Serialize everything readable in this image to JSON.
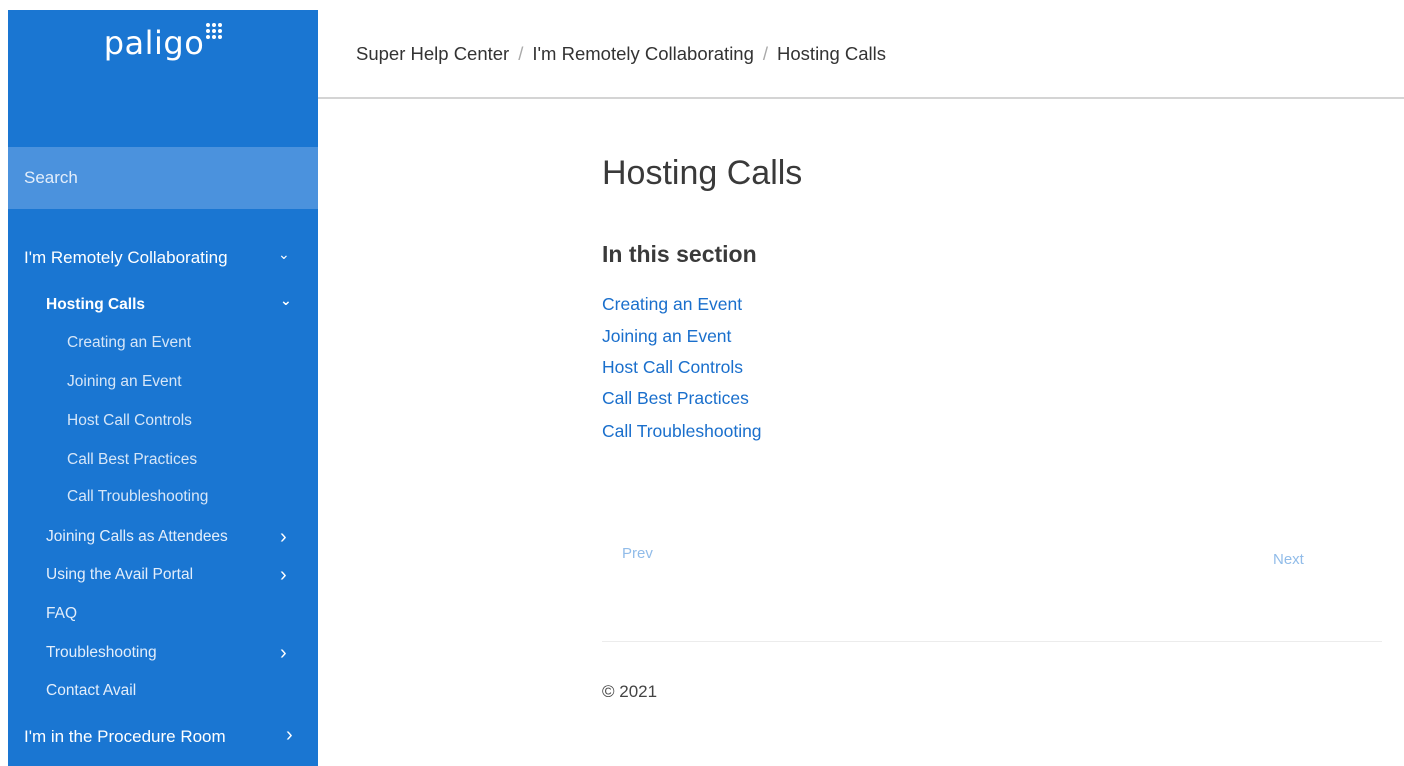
{
  "brand": {
    "logo_text": "paligo",
    "logo_icon": "dot-grid-icon"
  },
  "sidebar": {
    "search_label": "Search",
    "items": [
      {
        "label": "I'm Remotely Collaborating",
        "level": 0,
        "chevron": "chevron-down-icon"
      },
      {
        "label": "Hosting Calls",
        "level": 1,
        "active": true,
        "chevron": "chevron-down-icon"
      },
      {
        "label": "Creating an Event",
        "level": 2
      },
      {
        "label": "Joining an Event",
        "level": 2
      },
      {
        "label": "Host Call Controls",
        "level": 2
      },
      {
        "label": "Call Best Practices",
        "level": 2
      },
      {
        "label": "Call Troubleshooting",
        "level": 2
      },
      {
        "label": "Joining Calls as Attendees",
        "level": 1,
        "chevron": "chevron-right-icon"
      },
      {
        "label": "Using the Avail Portal",
        "level": 1,
        "chevron": "chevron-right-icon"
      },
      {
        "label": "FAQ",
        "level": 1
      },
      {
        "label": "Troubleshooting",
        "level": 1,
        "chevron": "chevron-right-icon"
      },
      {
        "label": "Contact Avail",
        "level": 1
      },
      {
        "label": "I'm in the Procedure Room",
        "level": 0,
        "chevron": "chevron-right-icon"
      }
    ],
    "chevron_down": "⌄",
    "chevron_right": "›"
  },
  "breadcrumb": {
    "items": [
      "Super Help Center",
      "I'm Remotely Collaborating",
      "Hosting Calls"
    ],
    "separator": "/"
  },
  "main": {
    "title": "Hosting Calls",
    "section_title": "In this section",
    "links": [
      "Creating an Event",
      "Joining an Event",
      "Host Call Controls",
      "Call Best Practices",
      "Call Troubleshooting"
    ],
    "prev_label": "Prev",
    "next_label": "Next"
  },
  "footer": {
    "copyright": "© 2021"
  },
  "colors": {
    "sidebar_bg": "#1a76d2",
    "search_bg": "#4b92dd",
    "link": "#1a6fcc",
    "pager_link": "#91bce9"
  }
}
